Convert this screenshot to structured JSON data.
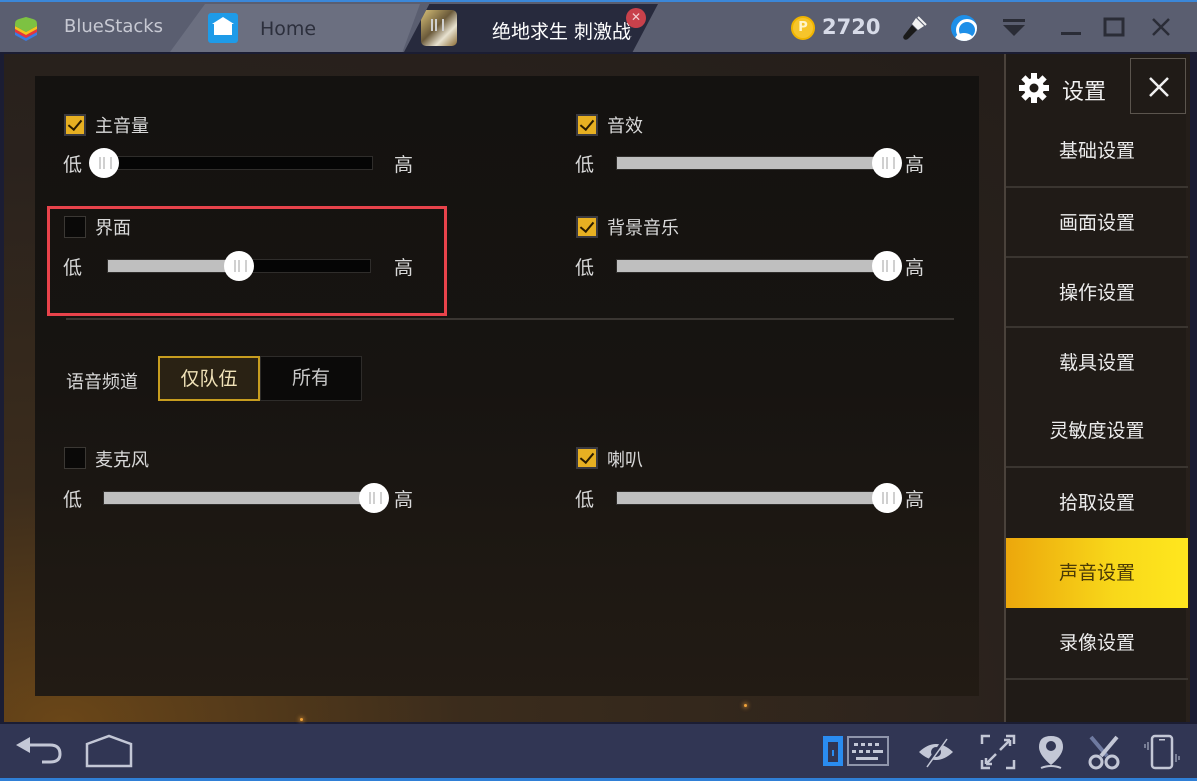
{
  "titlebar": {
    "app_name": "BlueStacks",
    "tabs": [
      {
        "label": "Home",
        "icon": "home-icon"
      },
      {
        "label": "绝地求生 刺激战场",
        "icon": "game-thumbnail",
        "close": "✕"
      }
    ],
    "coin_symbol": "P",
    "coin_count": "2720",
    "icons": [
      "brush-icon",
      "account-icon",
      "menu-dropdown-icon",
      "minimize-icon",
      "maximize-icon",
      "close-icon"
    ]
  },
  "settings": {
    "title": "设置",
    "close_glyph": "✕",
    "sidebar": [
      {
        "label": "基础设置",
        "active": false
      },
      {
        "label": "画面设置",
        "active": false
      },
      {
        "label": "操作设置",
        "active": false
      },
      {
        "label": "载具设置",
        "active": false
      },
      {
        "label": "灵敏度设置",
        "active": false
      },
      {
        "label": "拾取设置",
        "active": false
      },
      {
        "label": "声音设置",
        "active": true
      },
      {
        "label": "录像设置",
        "active": false
      }
    ],
    "accent_color": "#f5c518",
    "low_label": "低",
    "high_label": "高",
    "sound": {
      "master": {
        "label": "主音量",
        "checked": true,
        "value": 0
      },
      "effects": {
        "label": "音效",
        "checked": true,
        "value": 100
      },
      "ui": {
        "label": "界面",
        "checked": false,
        "value": 50
      },
      "bgm": {
        "label": "背景音乐",
        "checked": true,
        "value": 100
      },
      "voice_channel": {
        "label": "语音频道",
        "options": [
          "仅队伍",
          "所有"
        ],
        "selected": "仅队伍"
      },
      "microphone": {
        "label": "麦克风",
        "checked": false,
        "value": 100
      },
      "speaker": {
        "label": "喇叭",
        "checked": true,
        "value": 100
      }
    },
    "highlight_color": "#e8434b"
  },
  "bottombar": {
    "left_icons": [
      "back-icon",
      "home-icon"
    ],
    "right_icons": [
      "keyboard-mapping-icon",
      "eye-hidden-icon",
      "fullscreen-icon",
      "location-icon",
      "scissors-icon",
      "device-shake-icon"
    ]
  }
}
